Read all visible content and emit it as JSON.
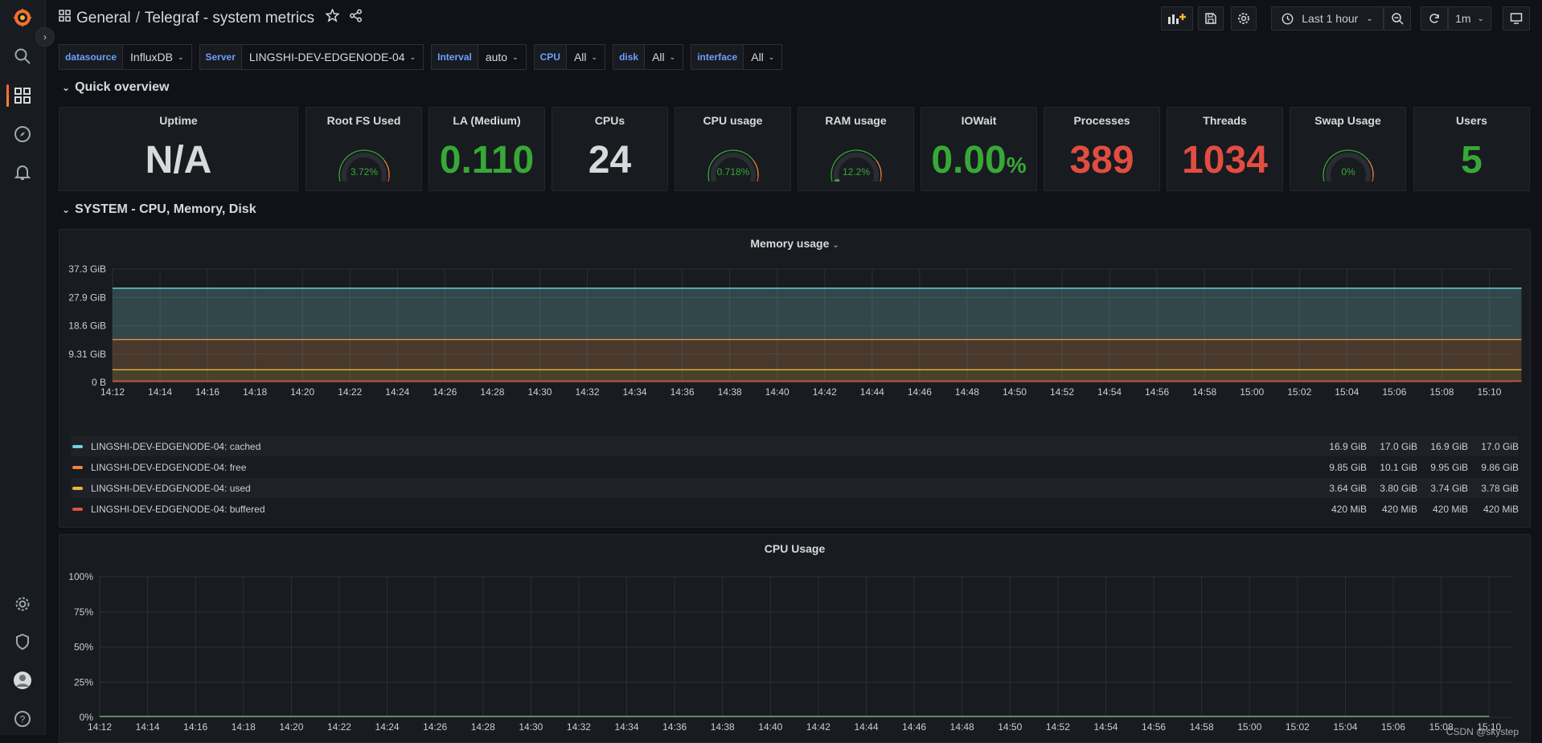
{
  "header": {
    "folder": "General",
    "separator": "/",
    "dashboard_title": "Telegraf - system metrics",
    "time_range": "Last 1 hour",
    "refresh": "1m"
  },
  "variables": [
    {
      "label": "datasource",
      "value": "InfluxDB"
    },
    {
      "label": "Server",
      "value": "LINGSHI-DEV-EDGENODE-04"
    },
    {
      "label": "Interval",
      "value": "auto"
    },
    {
      "label": "CPU",
      "value": "All"
    },
    {
      "label": "disk",
      "value": "All"
    },
    {
      "label": "interface",
      "value": "All"
    }
  ],
  "rows": {
    "quick_overview": "Quick overview",
    "system": "SYSTEM - CPU, Memory, Disk"
  },
  "stats": {
    "uptime": {
      "title": "Uptime",
      "value": "N/A",
      "color": "#d8d9da"
    },
    "root_fs": {
      "title": "Root FS Used",
      "value": "3.72%",
      "fraction": 0.0372
    },
    "la": {
      "title": "LA (Medium)",
      "value": "0.110",
      "color": "#37a838"
    },
    "cpus": {
      "title": "CPUs",
      "value": "24",
      "color": "#d8d9da"
    },
    "cpu_usage": {
      "title": "CPU usage",
      "value": "0.718%",
      "fraction": 0.00718
    },
    "ram_usage": {
      "title": "RAM usage",
      "value": "12.2%",
      "fraction": 0.122
    },
    "iowait": {
      "title": "IOWait",
      "value": "0.00",
      "unit": "%",
      "color": "#37a838"
    },
    "processes": {
      "title": "Processes",
      "value": "389",
      "color": "#e24d42"
    },
    "threads": {
      "title": "Threads",
      "value": "1034",
      "color": "#e24d42"
    },
    "swap": {
      "title": "Swap Usage",
      "value": "0%",
      "fraction": 0
    },
    "users": {
      "title": "Users",
      "value": "5",
      "color": "#37a838"
    }
  },
  "memory_panel": {
    "title": "Memory usage",
    "legend": [
      {
        "name": "LINGSHI-DEV-EDGENODE-04: cached",
        "color": "#6ed0e0",
        "values": [
          "16.9 GiB",
          "17.0 GiB",
          "16.9 GiB",
          "17.0 GiB"
        ]
      },
      {
        "name": "LINGSHI-DEV-EDGENODE-04: free",
        "color": "#ef843c",
        "values": [
          "9.85 GiB",
          "10.1 GiB",
          "9.95 GiB",
          "9.86 GiB"
        ]
      },
      {
        "name": "LINGSHI-DEV-EDGENODE-04: used",
        "color": "#eab839",
        "values": [
          "3.64 GiB",
          "3.80 GiB",
          "3.74 GiB",
          "3.78 GiB"
        ]
      },
      {
        "name": "LINGSHI-DEV-EDGENODE-04: buffered",
        "color": "#e24d42",
        "values": [
          "420 MiB",
          "420 MiB",
          "420 MiB",
          "420 MiB"
        ]
      }
    ]
  },
  "cpu_panel": {
    "title": "CPU Usage"
  },
  "watermark": "CSDN @skystep",
  "chart_data": [
    {
      "type": "area",
      "title": "Memory usage",
      "x": [
        "14:12",
        "14:14",
        "14:16",
        "14:18",
        "14:20",
        "14:22",
        "14:24",
        "14:26",
        "14:28",
        "14:30",
        "14:32",
        "14:34",
        "14:36",
        "14:38",
        "14:40",
        "14:42",
        "14:44",
        "14:46",
        "14:48",
        "14:50",
        "14:52",
        "14:54",
        "14:56",
        "14:58",
        "15:00",
        "15:02",
        "15:04",
        "15:06",
        "15:08",
        "15:10"
      ],
      "yticks": [
        "0 B",
        "9.31 GiB",
        "18.6 GiB",
        "27.9 GiB",
        "37.3 GiB"
      ],
      "ylim": [
        0,
        37.3
      ],
      "stacked": true,
      "series": [
        {
          "name": "LINGSHI-DEV-EDGENODE-04: buffered",
          "color": "#e24d42",
          "values": [
            0.41,
            0.41,
            0.41,
            0.41,
            0.41,
            0.41,
            0.41,
            0.41,
            0.41,
            0.41,
            0.41,
            0.41,
            0.41,
            0.41,
            0.41,
            0.41,
            0.41,
            0.41,
            0.41,
            0.41,
            0.41,
            0.41,
            0.41,
            0.41,
            0.41,
            0.41,
            0.41,
            0.41,
            0.41,
            0.41
          ]
        },
        {
          "name": "LINGSHI-DEV-EDGENODE-04: used",
          "color": "#eab839",
          "values": [
            3.74,
            3.74,
            3.74,
            3.74,
            3.74,
            3.74,
            3.74,
            3.74,
            3.74,
            3.74,
            3.74,
            3.74,
            3.74,
            3.74,
            3.74,
            3.74,
            3.74,
            3.74,
            3.74,
            3.74,
            3.74,
            3.74,
            3.74,
            3.74,
            3.74,
            3.74,
            3.74,
            3.74,
            3.74,
            3.74
          ]
        },
        {
          "name": "LINGSHI-DEV-EDGENODE-04: free",
          "color": "#ef843c",
          "values": [
            9.95,
            9.95,
            9.95,
            9.95,
            9.95,
            9.95,
            9.95,
            9.95,
            9.95,
            9.95,
            9.95,
            9.95,
            9.95,
            9.95,
            9.95,
            9.95,
            9.95,
            9.95,
            9.95,
            9.95,
            9.95,
            9.95,
            9.95,
            9.95,
            9.95,
            9.95,
            9.95,
            9.95,
            9.95,
            9.95
          ]
        },
        {
          "name": "LINGSHI-DEV-EDGENODE-04: cached",
          "color": "#6ed0e0",
          "values": [
            16.9,
            16.9,
            16.9,
            16.9,
            16.9,
            16.9,
            16.9,
            16.9,
            16.9,
            16.9,
            16.9,
            16.9,
            16.9,
            16.9,
            16.9,
            16.9,
            16.9,
            16.9,
            16.9,
            16.9,
            16.9,
            16.9,
            16.9,
            16.9,
            16.9,
            16.9,
            16.9,
            16.9,
            16.9,
            16.9
          ]
        }
      ],
      "total_line": {
        "color": "#b7dbab",
        "value": 31.0
      }
    },
    {
      "type": "area",
      "title": "CPU Usage",
      "x": [
        "14:12",
        "14:14",
        "14:16",
        "14:18",
        "14:20",
        "14:22",
        "14:24",
        "14:26",
        "14:28",
        "14:30",
        "14:32",
        "14:34",
        "14:36",
        "14:38",
        "14:40",
        "14:42",
        "14:44",
        "14:46",
        "14:48",
        "14:50",
        "14:52",
        "14:54",
        "14:56",
        "14:58",
        "15:00",
        "15:02",
        "15:04",
        "15:06",
        "15:08",
        "15:10"
      ],
      "yticks": [
        "0%",
        "25%",
        "50%",
        "75%",
        "100%"
      ],
      "ylim": [
        0,
        100
      ],
      "series": [
        {
          "color": "#7eb26d",
          "values": [
            0.7,
            0.7,
            0.7,
            0.7,
            0.7,
            0.7,
            0.7,
            0.7,
            0.7,
            0.7,
            0.7,
            0.7,
            0.7,
            0.7,
            0.7,
            0.7,
            0.7,
            0.7,
            0.7,
            0.7,
            0.7,
            0.7,
            0.7,
            0.7,
            0.7,
            0.7,
            0.7,
            0.7,
            0.7,
            0.7
          ]
        }
      ]
    }
  ]
}
